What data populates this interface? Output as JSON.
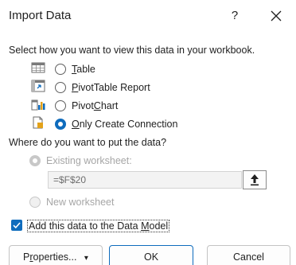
{
  "window": {
    "title": "Import Data",
    "help_label": "?"
  },
  "view": {
    "prompt": "Select how you want to view this data in your workbook.",
    "options": [
      {
        "label_pre": "",
        "label_key": "T",
        "label_post": "able",
        "selected": false,
        "icon": "table-icon"
      },
      {
        "label_pre": "",
        "label_key": "P",
        "label_post": "ivotTable Report",
        "selected": false,
        "icon": "pivottable-icon"
      },
      {
        "label_pre": "Pivot",
        "label_key": "C",
        "label_post": "hart",
        "selected": false,
        "icon": "pivotchart-icon"
      },
      {
        "label_pre": "",
        "label_key": "O",
        "label_post": "nly Create Connection",
        "selected": true,
        "icon": "connection-icon"
      }
    ]
  },
  "location": {
    "prompt": "Where do you want to put the data?",
    "existing_label": "Existing worksheet:",
    "existing_value": "=$F$20",
    "new_label": "New worksheet",
    "existing_selected": true,
    "enabled": false
  },
  "data_model": {
    "label_pre": "Add this data to the Data ",
    "label_key": "M",
    "label_post": "odel",
    "checked": true
  },
  "buttons": {
    "properties_pre": "P",
    "properties_key": "r",
    "properties_post": "operties...",
    "dropdown_glyph": "▾",
    "ok": "OK",
    "cancel": "Cancel"
  },
  "colors": {
    "accent": "#0f6cbd",
    "disabled": "#a6a6a6"
  }
}
